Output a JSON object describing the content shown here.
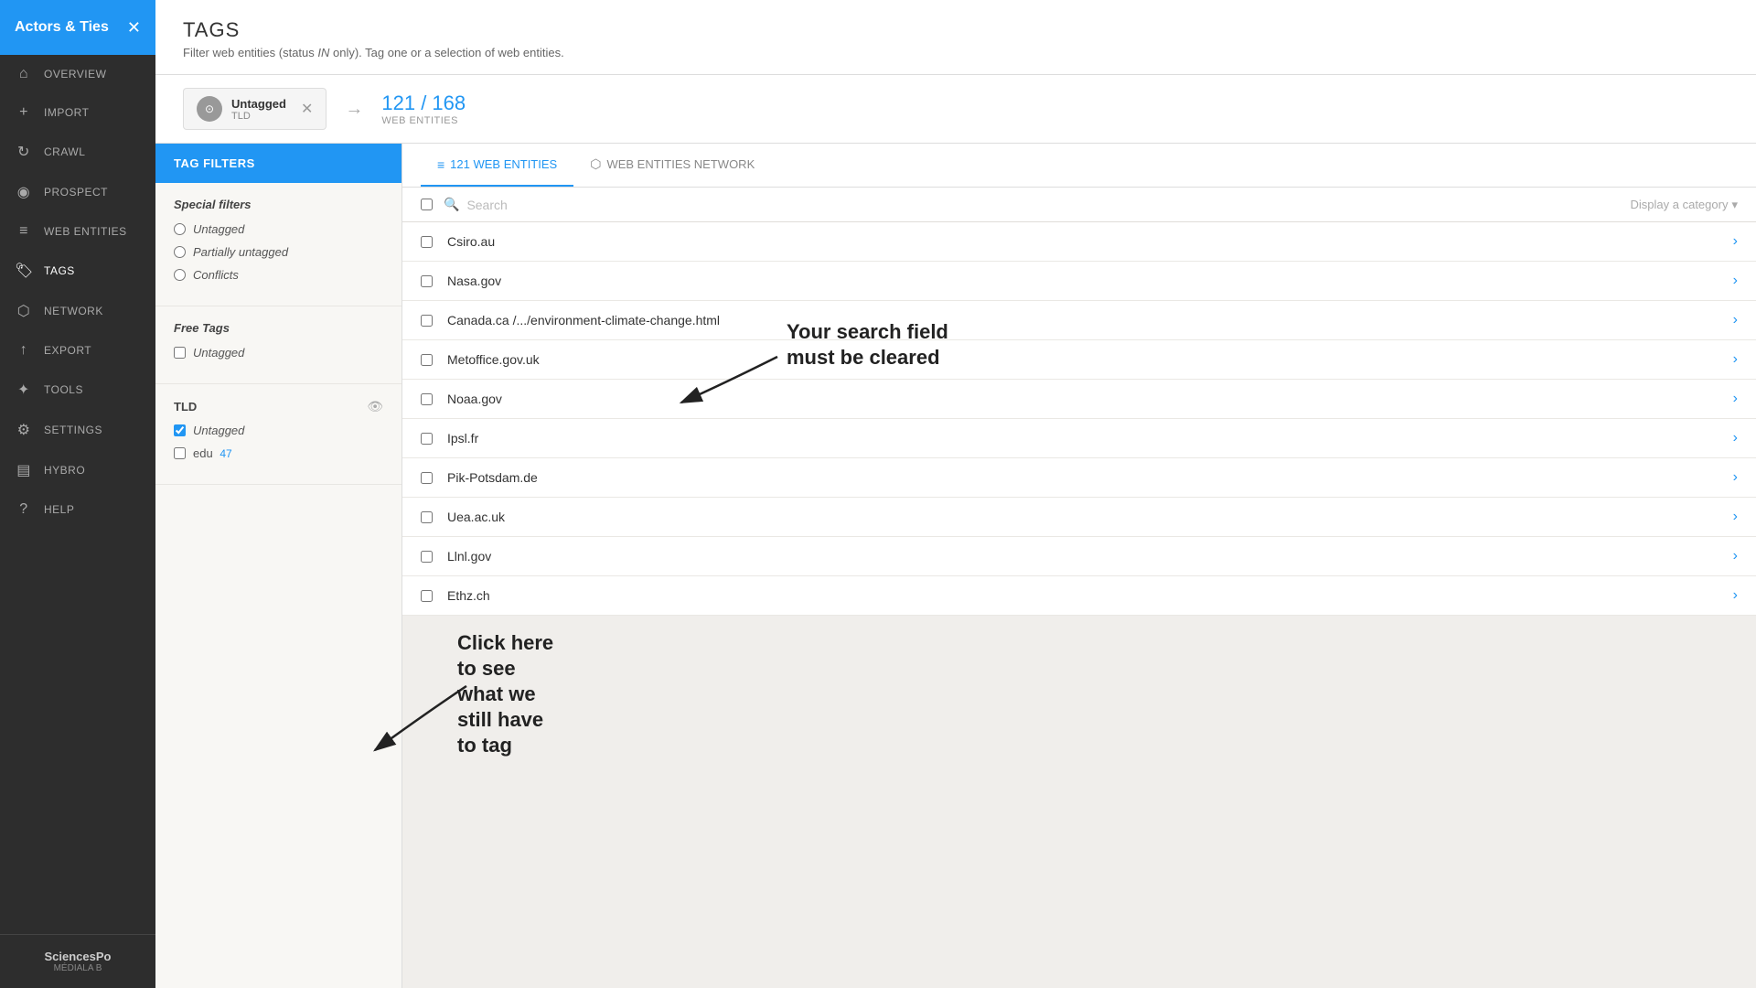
{
  "sidebar": {
    "title": "Actors & Ties",
    "items": [
      {
        "id": "overview",
        "label": "OVERVIEW",
        "icon": "⌂"
      },
      {
        "id": "import",
        "label": "IMPORT",
        "icon": "+"
      },
      {
        "id": "crawl",
        "label": "CRAWL",
        "icon": "↻"
      },
      {
        "id": "prospect",
        "label": "PROSPECT",
        "icon": "◉"
      },
      {
        "id": "web-entities",
        "label": "WEB ENTITIES",
        "icon": "≡"
      },
      {
        "id": "tags",
        "label": "TAGS",
        "icon": "🏷"
      },
      {
        "id": "network",
        "label": "NETWORK",
        "icon": "⬡"
      },
      {
        "id": "export",
        "label": "EXPORT",
        "icon": "↑"
      },
      {
        "id": "tools",
        "label": "TOOLS",
        "icon": "✦"
      },
      {
        "id": "settings",
        "label": "SETTINGS",
        "icon": "⚙"
      },
      {
        "id": "hybro",
        "label": "HYBRO",
        "icon": "▤"
      },
      {
        "id": "help",
        "label": "HELP",
        "icon": "?"
      }
    ],
    "brand_name": "SciencesPo",
    "brand_sub": "MÉDIALA B"
  },
  "page": {
    "title": "TAGS",
    "subtitle": "Filter web entities (status IN only). Tag one or a selection of web entities."
  },
  "filter_bar": {
    "tag_icon": "⊙",
    "tag_name": "Untagged",
    "tag_sub": "TLD",
    "arrow": "→",
    "count_num": "121",
    "count_separator": "/",
    "count_total": "168",
    "count_label": "WEB ENTITIES"
  },
  "tabs": [
    {
      "id": "web-entities-tab",
      "label": "121 WEB ENTITIES",
      "icon": "≡",
      "active": true
    },
    {
      "id": "network-tab",
      "label": "WEB ENTITIES NETWORK",
      "icon": "⬡",
      "active": false
    }
  ],
  "panel": {
    "header": "TAG FILTERS",
    "special_filters_title": "Special filters",
    "special_filters": [
      {
        "id": "untagged-radio",
        "label": "Untagged"
      },
      {
        "id": "partially-radio",
        "label": "Partially untagged"
      },
      {
        "id": "conflicts-radio",
        "label": "Conflicts"
      }
    ],
    "free_tags_title": "Free Tags",
    "free_tags": [
      {
        "id": "free-untagged",
        "label": "Untagged",
        "italic": true
      }
    ],
    "tld_group": "TLD",
    "tld_tags": [
      {
        "id": "tld-untagged",
        "label": "Untagged",
        "checked": true
      },
      {
        "id": "tld-edu",
        "label": "edu",
        "count": "47"
      }
    ]
  },
  "search": {
    "placeholder": "Search",
    "display_category_label": "Display a category"
  },
  "entities": [
    {
      "id": "e1",
      "name": "Csiro.au"
    },
    {
      "id": "e2",
      "name": "Nasa.gov"
    },
    {
      "id": "e3",
      "name": "Canada.ca /.../environment-climate-change.html"
    },
    {
      "id": "e4",
      "name": "Metoffice.gov.uk"
    },
    {
      "id": "e5",
      "name": "Noaa.gov"
    },
    {
      "id": "e6",
      "name": "Ipsl.fr"
    },
    {
      "id": "e7",
      "name": "Pik-Potsdam.de"
    },
    {
      "id": "e8",
      "name": "Uea.ac.uk"
    },
    {
      "id": "e9",
      "name": "Llnl.gov"
    },
    {
      "id": "e10",
      "name": "Ethz.ch"
    }
  ],
  "callouts": {
    "search_callout": "Your search field\nmust be cleared",
    "click_callout": "Click here\nto see\nwhat we\nstill have\nto tag"
  }
}
